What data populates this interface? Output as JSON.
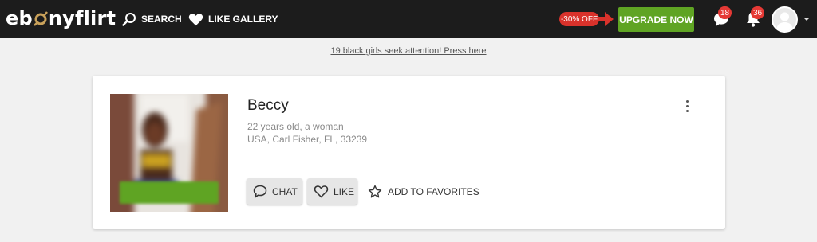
{
  "header": {
    "logo": {
      "part1": "eb",
      "part2": "nyflirt"
    },
    "nav": [
      {
        "label": "SEARCH",
        "icon": "search-icon"
      },
      {
        "label": "LIKE GALLERY",
        "icon": "heart-icon"
      }
    ],
    "discount_label": "-30% OFF",
    "upgrade_label": "UPGRADE NOW",
    "messages_count": "18",
    "notifications_count": "36"
  },
  "promo_link": "19 black girls seek attention! Press here",
  "profile": {
    "name": "Beccy",
    "age_line": "22 years old, a woman",
    "location_line": "USA, Carl Fisher, FL, 33239",
    "actions": {
      "chat_label": "CHAT",
      "like_label": "LIKE",
      "favorites_label": "ADD TO FAVORITES"
    }
  },
  "colors": {
    "header_bg": "#1c1c1c",
    "upgrade_green": "#5fa423",
    "badge_red": "#e53935",
    "logo_gold": "#c9a15a",
    "page_bg": "#f1f1f1"
  }
}
